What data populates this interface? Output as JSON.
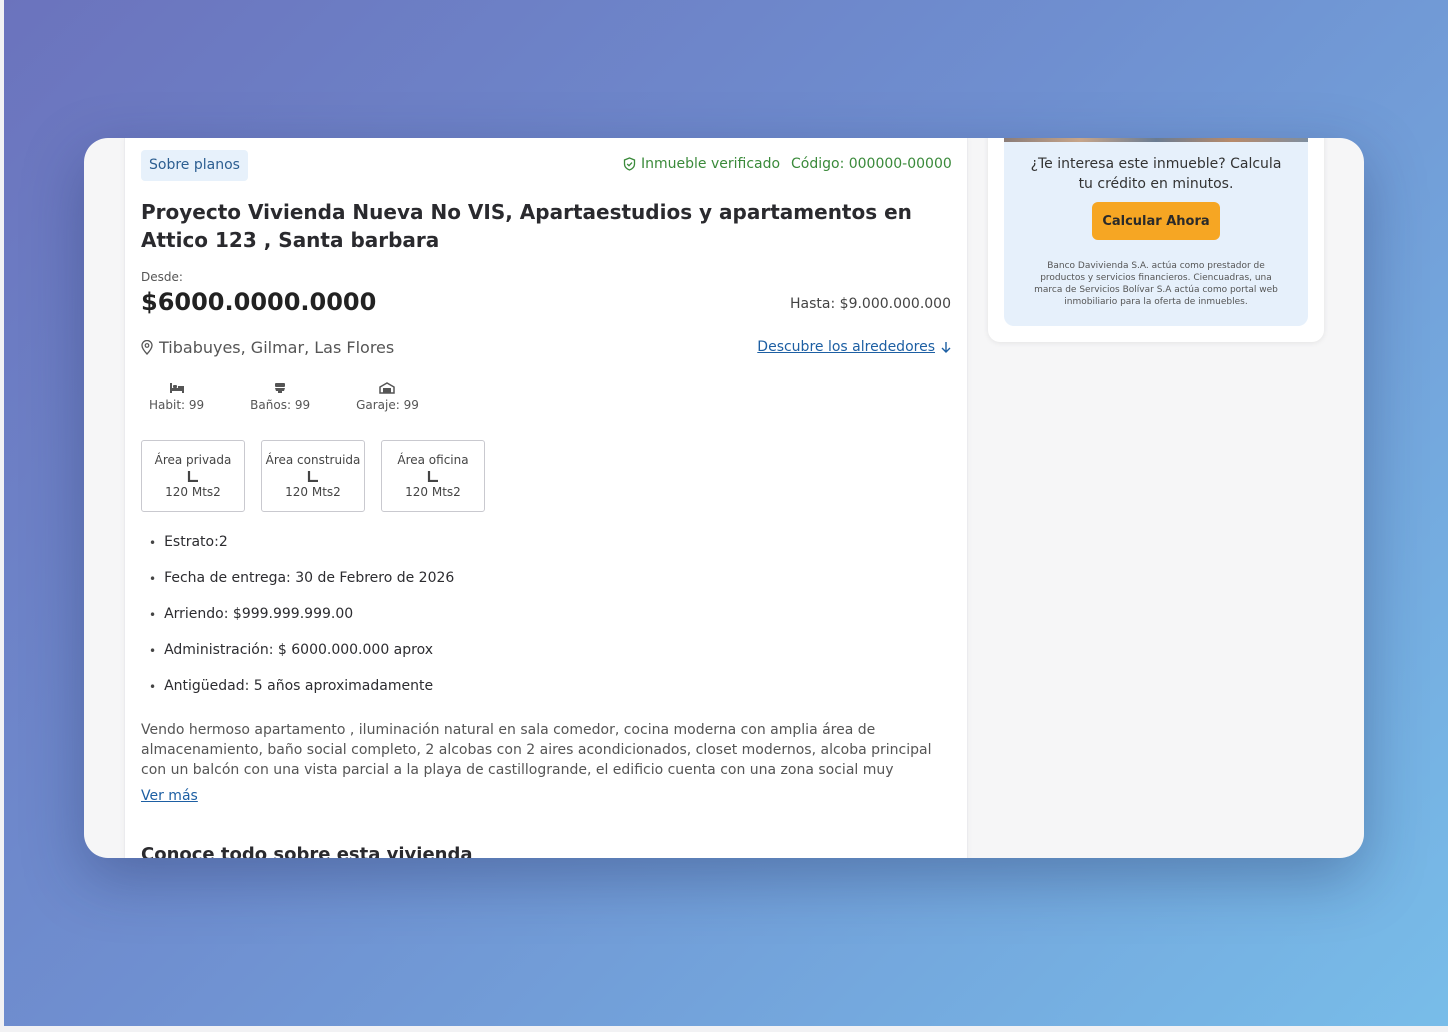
{
  "listing": {
    "badge": "Sobre planos",
    "verified": "Inmueble verificado",
    "code": "Código: 000000-00000",
    "title": "Proyecto Vivienda Nueva No VIS, Apartaestudios y apartamentos en Attico 123 , Santa barbara",
    "desde_label": "Desde:",
    "price": "$6000.0000.0000",
    "hasta": "Hasta: $9.000.000.000",
    "location": "Tibabuyes, Gilmar,  Las Flores",
    "discover_link": "Descubre los alrededores",
    "features": [
      {
        "icon": "bed-icon",
        "label": "Habit: 99"
      },
      {
        "icon": "toilet-icon",
        "label": "Baños: 99"
      },
      {
        "icon": "garage-icon",
        "label": "Garaje: 99"
      }
    ],
    "areas": [
      {
        "title": "Área privada",
        "value": "120 Mts2"
      },
      {
        "title": "Área construida",
        "value": "120 Mts2"
      },
      {
        "title": "Área oficina",
        "value": "120 Mts2"
      }
    ],
    "details": [
      "Estrato:2",
      "Fecha de entrega: 30 de Febrero de 2026",
      "Arriendo: $999.999.999.00",
      "Administración: $ 6000.000.000 aprox",
      "Antigüedad: 5 años aproximadamente"
    ],
    "description": "Vendo hermoso apartamento , iluminación natural en sala comedor, cocina moderna con amplia área de almacenamiento, baño social completo, 2 alcobas con 2 aires acondicionados, closet modernos, alcoba principal con un balcón con una vista parcial a la playa de castillogrande, el edificio cuenta con una zona social muy completa, planta eléctrica, un piso pensado en",
    "ver_mas": "Ver más",
    "section_title": "Conoce todo sobre esta vivienda"
  },
  "sidebar": {
    "promo_text": "¿Te interesa este inmueble? Calcula tu crédito en minutos.",
    "cta_label": "Calcular Ahora",
    "disclaimer": "Banco Davivienda S.A. actúa como prestador de productos y servicios financieros. Ciencuadras, una marca de Servicios Bolívar S.A actúa  como portal web inmobiliario para la oferta de inmuebles."
  },
  "colors": {
    "accent": "#1d5fa3",
    "verified": "#3a8a3a",
    "cta": "#f6a623",
    "badge_bg": "#e7f1fb"
  }
}
